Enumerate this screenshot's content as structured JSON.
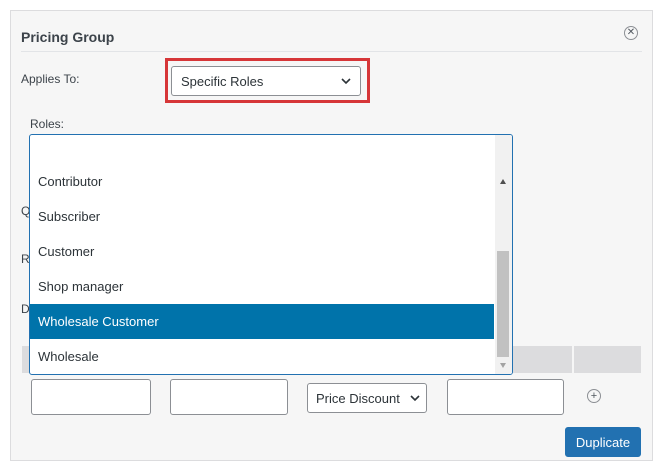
{
  "dialog": {
    "title": "Pricing Group"
  },
  "applies_to": {
    "label": "Applies To:",
    "selected": "Specific Roles"
  },
  "roles": {
    "label": "Roles:",
    "options": [
      {
        "label": "Contributor",
        "selected": false
      },
      {
        "label": "Subscriber",
        "selected": false
      },
      {
        "label": "Customer",
        "selected": false
      },
      {
        "label": "Shop manager",
        "selected": false
      },
      {
        "label": "Wholesale Customer",
        "selected": true
      },
      {
        "label": "Wholesale",
        "selected": false
      }
    ]
  },
  "hidden_labels": {
    "q": "Q",
    "r": "R",
    "d": "D"
  },
  "rule_row": {
    "discount_type": "Price Discount"
  },
  "actions": {
    "duplicate_label": "Duplicate"
  },
  "colors": {
    "accent": "#2271b1",
    "selected_option": "#0073aa",
    "highlight_border": "#d63638"
  }
}
